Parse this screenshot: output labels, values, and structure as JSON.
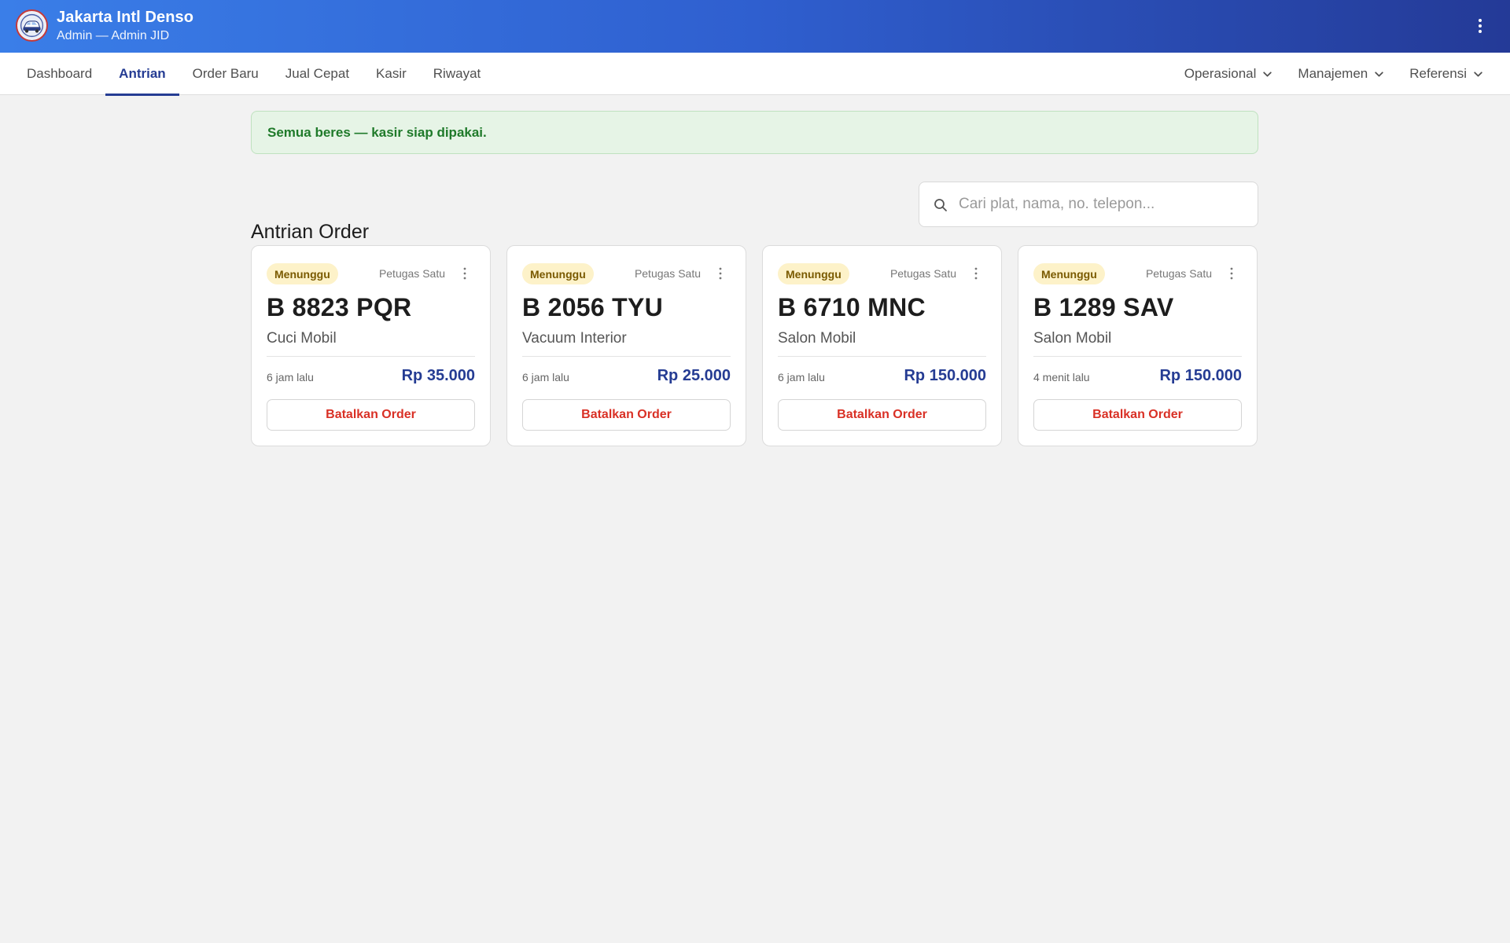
{
  "header": {
    "title": "Jakarta Intl Denso",
    "subtitle": "Admin — Admin JID",
    "menu_icon": "kebab-vertical-icon"
  },
  "nav": {
    "tabs": [
      {
        "label": "Dashboard",
        "active": false
      },
      {
        "label": "Antrian",
        "active": true
      },
      {
        "label": "Order Baru",
        "active": false
      },
      {
        "label": "Jual Cepat",
        "active": false
      },
      {
        "label": "Kasir",
        "active": false
      },
      {
        "label": "Riwayat",
        "active": false
      }
    ],
    "dropdowns": [
      {
        "label": "Operasional"
      },
      {
        "label": "Manajemen"
      },
      {
        "label": "Referensi"
      }
    ]
  },
  "alert": {
    "text": "Semua beres — kasir siap dipakai."
  },
  "section": {
    "title": "Antrian Order",
    "search_placeholder": "Cari plat, nama, no. telepon...",
    "search_value": ""
  },
  "orders": [
    {
      "status": "Menunggu",
      "staff": "Petugas Satu",
      "plate": "B 8823 PQR",
      "service": "Cuci Mobil",
      "time": "6 jam lalu",
      "price": "Rp 35.000",
      "action": "Batalkan Order"
    },
    {
      "status": "Menunggu",
      "staff": "Petugas Satu",
      "plate": "B 2056 TYU",
      "service": "Vacuum Interior",
      "time": "6 jam lalu",
      "price": "Rp 25.000",
      "action": "Batalkan Order"
    },
    {
      "status": "Menunggu",
      "staff": "Petugas Satu",
      "plate": "B 6710 MNC",
      "service": "Salon Mobil",
      "time": "6 jam lalu",
      "price": "Rp 150.000",
      "action": "Batalkan Order"
    },
    {
      "status": "Menunggu",
      "staff": "Petugas Satu",
      "plate": "B 1289 SAV",
      "service": "Salon Mobil",
      "time": "4 menit lalu",
      "price": "Rp 150.000",
      "action": "Batalkan Order"
    }
  ],
  "colors": {
    "primary": "#253c93",
    "header_start": "#3a7ee8",
    "header_end": "#243a97",
    "success_bg": "#e6f4e6",
    "success_text": "#1f7a2a",
    "badge_bg": "#fdf2c9",
    "danger": "#d93025"
  }
}
